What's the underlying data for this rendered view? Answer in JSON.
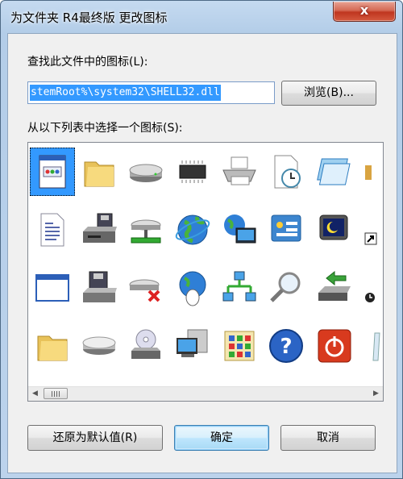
{
  "window": {
    "title": "为文件夹 R4最终版 更改图标",
    "close_label": "x"
  },
  "find_label": "查找此文件中的图标(L):",
  "path_input": {
    "value": "stemRoot%\\system32\\SHELL32.dll"
  },
  "browse_button": "浏览(B)...",
  "select_label": "从以下列表中选择一个图标(S):",
  "icons": [
    [
      "document-window-icon",
      "folder-icon",
      "drive-icon",
      "chip-icon",
      "printer-icon",
      "clock-document-icon",
      "window-stack-icon",
      "partial-icon"
    ],
    [
      "text-document-icon",
      "floppy-drive-icon",
      "network-drive-icon",
      "globe-icon",
      "globe-monitor-icon",
      "control-panel-icon",
      "monitor-moon-icon",
      "shortcut-arrow-icon"
    ],
    [
      "blank-window-icon",
      "floppy-disk-icon",
      "disconnected-drive-icon",
      "globe-mouse-icon",
      "network-icon",
      "magnifier-icon",
      "removable-drive-icon",
      "power-clock-icon"
    ],
    [
      "folder-icon",
      "disc-drive-icon",
      "cd-drive-icon",
      "computer-icon",
      "program-grid-icon",
      "help-icon",
      "shutdown-icon",
      "recycle-bin-icon"
    ]
  ],
  "scrollbar": {
    "left_arrow": "◀",
    "right_arrow": "▶"
  },
  "buttons": {
    "restore": "还原为默认值(R)",
    "ok": "确定",
    "cancel": "取消"
  }
}
